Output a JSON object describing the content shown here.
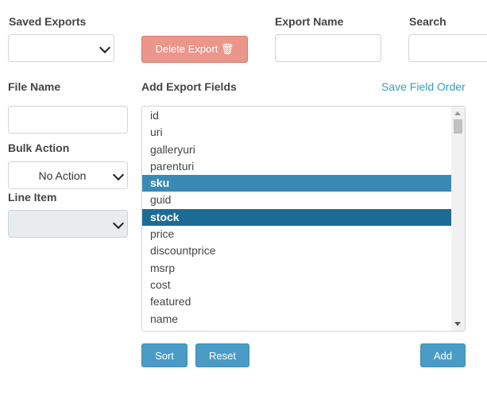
{
  "saved_exports": {
    "label": "Saved Exports",
    "value": ""
  },
  "delete_button": {
    "label": "Delete Export 🗑"
  },
  "export_name": {
    "label": "Export Name",
    "value": ""
  },
  "search": {
    "label": "Search",
    "value": ""
  },
  "file_name": {
    "label": "File Name",
    "value": ""
  },
  "add_export_fields": {
    "label": "Add Export Fields"
  },
  "save_field_order": {
    "label": "Save Field Order"
  },
  "bulk_action": {
    "label": "Bulk Action",
    "selected": "No Action"
  },
  "line_item": {
    "label": "Line Item",
    "selected": ""
  },
  "fields": [
    {
      "name": "id",
      "state": "none"
    },
    {
      "name": "uri",
      "state": "none"
    },
    {
      "name": "galleryuri",
      "state": "none"
    },
    {
      "name": "parenturi",
      "state": "none"
    },
    {
      "name": "sku",
      "state": "selected"
    },
    {
      "name": "guid",
      "state": "none"
    },
    {
      "name": "stock",
      "state": "selected-focus"
    },
    {
      "name": "price",
      "state": "none"
    },
    {
      "name": "discountprice",
      "state": "none"
    },
    {
      "name": "msrp",
      "state": "none"
    },
    {
      "name": "cost",
      "state": "none"
    },
    {
      "name": "featured",
      "state": "none"
    },
    {
      "name": "name",
      "state": "none"
    }
  ],
  "buttons": {
    "sort": "Sort",
    "reset": "Reset",
    "add": "Add"
  },
  "colors": {
    "primary": "#4a9cc7",
    "danger": "#eb968a",
    "selected": "#3a8ab6",
    "selected_focus": "#1c6b94",
    "link": "#3a9cc0"
  }
}
